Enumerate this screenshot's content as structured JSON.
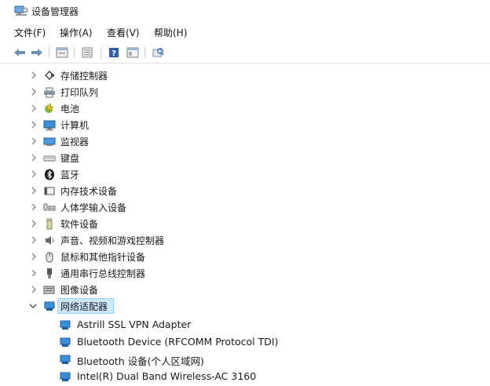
{
  "window": {
    "title": "设备管理器",
    "icon": "device-manager-icon"
  },
  "menu": [
    {
      "label": "文件(F)"
    },
    {
      "label": "操作(A)"
    },
    {
      "label": "查看(V)"
    },
    {
      "label": "帮助(H)"
    }
  ],
  "toolbar": {
    "buttons": [
      "back-icon",
      "forward-icon",
      "properties-icon",
      "update-driver-icon",
      "help-icon",
      "view-icon",
      "scan-hardware-icon"
    ]
  },
  "tree": {
    "categories": [
      {
        "label": "存储控制器",
        "icon": "storage-icon",
        "expanded": false
      },
      {
        "label": "打印队列",
        "icon": "printer-icon",
        "expanded": false
      },
      {
        "label": "电池",
        "icon": "battery-icon",
        "expanded": false
      },
      {
        "label": "计算机",
        "icon": "computer-icon",
        "expanded": false
      },
      {
        "label": "监视器",
        "icon": "monitor-icon",
        "expanded": false
      },
      {
        "label": "键盘",
        "icon": "keyboard-icon",
        "expanded": false
      },
      {
        "label": "蓝牙",
        "icon": "bluetooth-icon",
        "expanded": false
      },
      {
        "label": "内存技术设备",
        "icon": "memory-icon",
        "expanded": false
      },
      {
        "label": "人体学输入设备",
        "icon": "hid-icon",
        "expanded": false
      },
      {
        "label": "软件设备",
        "icon": "software-icon",
        "expanded": false
      },
      {
        "label": "声音、视频和游戏控制器",
        "icon": "speaker-icon",
        "expanded": false
      },
      {
        "label": "鼠标和其他指针设备",
        "icon": "mouse-icon",
        "expanded": false
      },
      {
        "label": "通用串行总线控制器",
        "icon": "usb-icon",
        "expanded": false
      },
      {
        "label": "图像设备",
        "icon": "camera-icon",
        "expanded": false
      },
      {
        "label": "网络适配器",
        "icon": "network-adapter-icon",
        "expanded": true,
        "selected": true
      }
    ],
    "network_adapters": [
      {
        "label": "Astrill SSL VPN Adapter"
      },
      {
        "label": "Bluetooth Device (RFCOMM Protocol TDI)"
      },
      {
        "label": "Bluetooth 设备(个人区域网)"
      },
      {
        "label": "Intel(R) Dual Band Wireless-AC 3160"
      }
    ]
  },
  "colors": {
    "selection": "#cce8ff",
    "selection_border": "#99d1ff",
    "accent": "#1e73be"
  }
}
